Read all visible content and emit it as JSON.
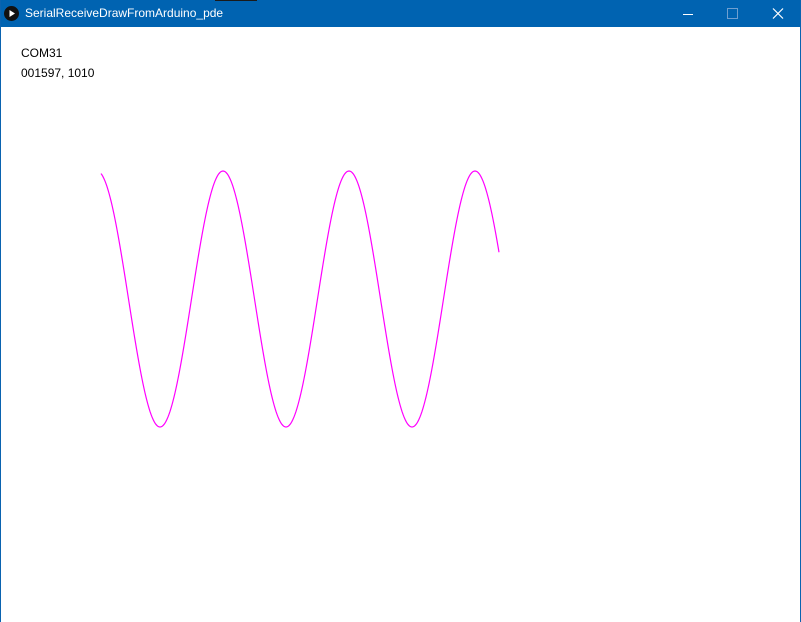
{
  "window": {
    "title": "SerialReceiveDrawFromArduino_pde",
    "app_icon": "processing-play-icon",
    "controls": {
      "minimize": "minimize-icon",
      "maximize": "maximize-icon",
      "close": "close-icon"
    },
    "titlebar_color": "#0063b1"
  },
  "canvas": {
    "port": "COM31",
    "reading": "001597, 1010",
    "waveform_color": "#ff00ff"
  }
}
